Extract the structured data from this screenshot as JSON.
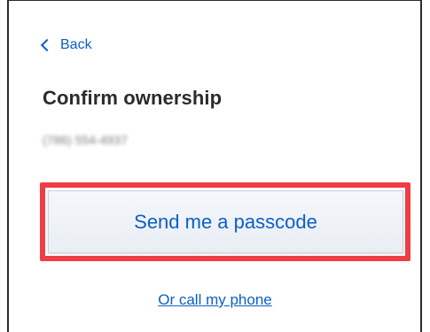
{
  "nav": {
    "back_label": "Back"
  },
  "page": {
    "title": "Confirm ownership",
    "phone_number_blurred": "(786) 554-4937"
  },
  "actions": {
    "send_passcode_label": "Send me a passcode",
    "call_phone_label": "Or call my phone"
  },
  "colors": {
    "link_blue": "#0b5fc5",
    "highlight_red": "#ef3c45",
    "title_text": "#2b2b2b"
  }
}
